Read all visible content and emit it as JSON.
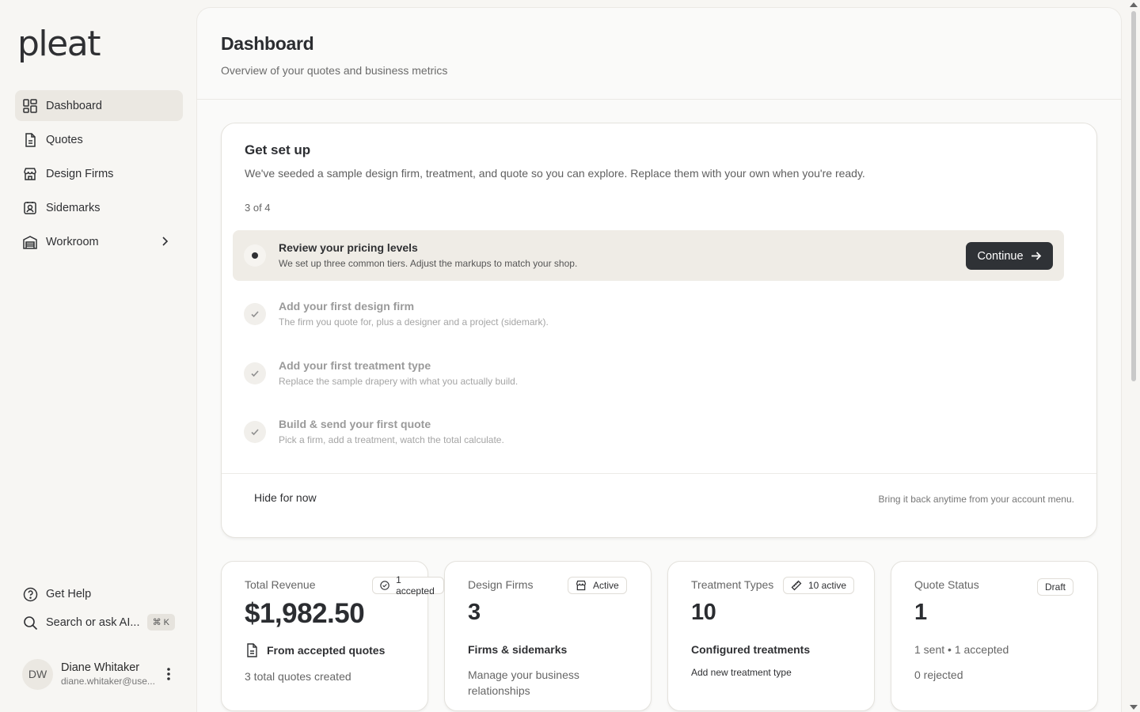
{
  "brand": {
    "logo": "pleat"
  },
  "sidebar": {
    "items": [
      {
        "label": "Dashboard",
        "icon": "dashboard-grid-icon",
        "active": true
      },
      {
        "label": "Quotes",
        "icon": "document-icon"
      },
      {
        "label": "Design Firms",
        "icon": "storefront-icon"
      },
      {
        "label": "Sidemarks",
        "icon": "contact-badge-icon"
      },
      {
        "label": "Workroom",
        "icon": "warehouse-icon",
        "has_submenu": true
      }
    ],
    "bottom": {
      "help": "Get Help",
      "search": "Search or ask AI...",
      "shortcut": "⌘ K"
    },
    "user": {
      "initials": "DW",
      "name": "Diane Whitaker",
      "email": "diane.whitaker@use..."
    }
  },
  "header": {
    "title": "Dashboard",
    "subtitle": "Overview of your quotes and business metrics"
  },
  "setup": {
    "title": "Get set up",
    "description": "We've seeded a sample design firm, treatment, and quote so you can explore. Replace them with your own when you're ready.",
    "progress": "3 of 4",
    "tasks": [
      {
        "title": "Review your pricing levels",
        "desc": "We set up three common tiers. Adjust the markups to match your shop.",
        "status": "current"
      },
      {
        "title": "Add your first design firm",
        "desc": "The firm you quote for, plus a designer and a project (sidemark).",
        "status": "done"
      },
      {
        "title": "Add your first treatment type",
        "desc": "Replace the sample drapery with what you actually build.",
        "status": "done"
      },
      {
        "title": "Build & send your first quote",
        "desc": "Pick a firm, add a treatment, watch the total calculate.",
        "status": "done"
      }
    ],
    "continue_label": "Continue",
    "hide_label": "Hide for now",
    "footer_note": "Bring it back anytime from your account menu."
  },
  "stats": [
    {
      "label": "Total Revenue",
      "badge": "1 accepted",
      "value": "$1,982.50",
      "line1": "From accepted quotes",
      "line2": "3 total quotes created"
    },
    {
      "label": "Design Firms",
      "badge": "Active",
      "value": "3",
      "line1": "Firms & sidemarks",
      "line2": "Manage your business relationships"
    },
    {
      "label": "Treatment Types",
      "badge": "10 active",
      "value": "10",
      "line1": "Configured treatments",
      "line2": "Add new treatment type"
    },
    {
      "label": "Quote Status",
      "badge": "Draft",
      "value": "1",
      "line1": "1 sent • 1 accepted",
      "line2": "0 rejected"
    }
  ]
}
